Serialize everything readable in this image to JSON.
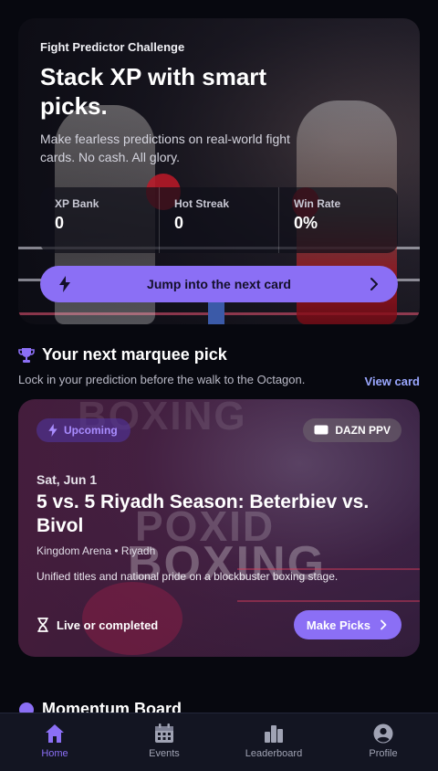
{
  "hero": {
    "eyebrow": "Fight Predictor Challenge",
    "title": "Stack XP with smart picks.",
    "subtitle": "Make fearless predictions on real-world fight cards. No cash. All glory.",
    "stats": [
      {
        "label": "XP Bank",
        "value": "0"
      },
      {
        "label": "Hot Streak",
        "value": "0"
      },
      {
        "label": "Win Rate",
        "value": "0%"
      }
    ],
    "cta_label": "Jump into the next card"
  },
  "marquee": {
    "title": "Your next marquee pick",
    "subtitle": "Lock in your prediction before the walk to the Octagon.",
    "view_link": "View card"
  },
  "event": {
    "status_pill": "Upcoming",
    "broadcast_pill": "DAZN PPV",
    "background_words": [
      "BOXING",
      "POXID",
      "BOXING"
    ],
    "date": "Sat, Jun 1",
    "title": "5 vs. 5 Riyadh Season: Beterbiev vs. Bivol",
    "venue": "Kingdom Arena • Riyadh",
    "description": "Unified titles and national pride on a blockbuster boxing stage.",
    "status_text": "Live or completed",
    "button_label": "Make Picks"
  },
  "momentum": {
    "title": "Momentum Board"
  },
  "nav": {
    "items": [
      {
        "label": "Home",
        "icon": "home-icon",
        "active": true
      },
      {
        "label": "Events",
        "icon": "calendar-icon",
        "active": false
      },
      {
        "label": "Leaderboard",
        "icon": "leaderboard-icon",
        "active": false
      },
      {
        "label": "Profile",
        "icon": "profile-icon",
        "active": false
      }
    ]
  },
  "colors": {
    "accent": "#8b6ff5",
    "link": "#9aa7ff",
    "background": "#07080f",
    "nav_bg": "#131522"
  }
}
